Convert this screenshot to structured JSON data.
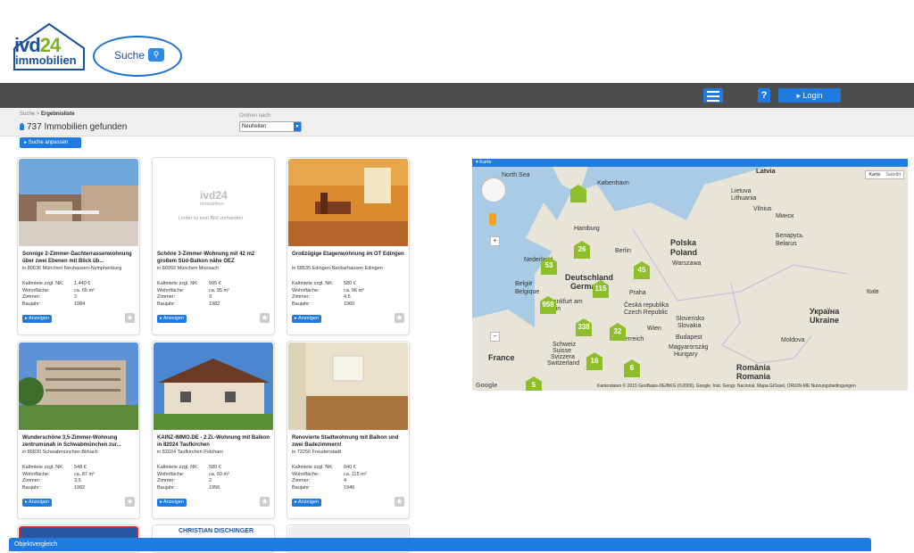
{
  "header": {
    "logo_line1": "ivd",
    "logo_line1_accent": "24",
    "logo_line2": "immobilien",
    "search_label": "Suche",
    "login_label": "Login",
    "help_label": "?"
  },
  "subbar": {
    "breadcrumb_root": "Suche",
    "breadcrumb_sep": ">",
    "breadcrumb_current": "Ergebnisliste",
    "result_count": "737 Immobilien gefunden",
    "sort_label": "Ordnen nach",
    "sort_value": "Neuheiten",
    "adjust_button": "Suche anpassen"
  },
  "listings": [
    {
      "title": "Sonnige 2-Zimmer-Dachterrassenwohnung über zwei Ebenen mit Blick üb...",
      "location": "in 80636 München Neuhausen-Nymphenburg",
      "rent": "1.440 €",
      "area": "ca. 65 m²",
      "rooms": "2",
      "year": "1984"
    },
    {
      "title": "Schöne 3-Zimmer-Wohnung mit 42 m2 großem Süd-Balkon nähe OEZ",
      "location": "in 80992 München Moosach",
      "rent": "995 €",
      "area": "ca. 95 m²",
      "rooms": "3",
      "year": "1982"
    },
    {
      "title": "Großzügige Etagenwohnung im OT Edingen",
      "location": "in 68535 Edingen-Neckarhausen Edingen",
      "rent": "580 €",
      "area": "ca. 96 m²",
      "rooms": "4,5",
      "year": "1960"
    },
    {
      "title": "Wunderschöne 3,5-Zimmer-Wohnung zentrumsnah in Schwabmünchen zur...",
      "location": "in 86830 Schwabmünchen Birkach",
      "rent": "548 €",
      "area": "ca. 87 m²",
      "rooms": "3,5",
      "year": "1982"
    },
    {
      "title": "KAINZ-IMMO.DE - 2 Zi.-Wohnung mit Balkon in 82024 Taufkirchen",
      "location": "in 82024 Taufkirchen Potzham",
      "rent": "580 €",
      "area": "ca. 60 m²",
      "rooms": "2",
      "year": "1956"
    },
    {
      "title": "Renovierte Stadtwohnung mit Balkon und zwei Badezimmern!",
      "location": "in 72250 Freudenstadt",
      "rent": "640 €",
      "area": "ca. 115 m²",
      "rooms": "4",
      "year": "1949"
    }
  ],
  "listing_labels": {
    "rent": "Kaltmiete zzgl. NK:",
    "area": "Wohnfläche:",
    "rooms": "Zimmer:",
    "year": "Baujahr:",
    "show_button": "Anzeigen",
    "no_image_text": "Leider ist kein Bild vorhanden.",
    "no_image_logo": "ivd24",
    "no_image_logo_sub": "immobilien",
    "partial_card_text": "CHRISTIAN DISCHINGER"
  },
  "map": {
    "header": "Karte",
    "maptype_map": "Karte",
    "maptype_sat": "Satellit",
    "labels": [
      "North Sea",
      "København",
      "Latvia",
      "Lietuva",
      "Lithuania",
      "Vilnius",
      "Hamburg",
      "Berlin",
      "Polska",
      "Poland",
      "Warszawa",
      "Минск",
      "Беларусь",
      "Belarus",
      "Deutschland",
      "Germany",
      "Praha",
      "Nederland",
      "België",
      "Belgique",
      "Frankfurt am Main",
      "Česká republika",
      "Czech Republic",
      "Slovensko",
      "Slovakia",
      "Україна",
      "Ukraine",
      "Schweiz",
      "Suisse",
      "Svizzera",
      "Switzerland",
      "Österreich",
      "Wien",
      "Budapest",
      "Magyarország",
      "Hungary",
      "Moldova",
      "France",
      "România",
      "Romania",
      "Київ"
    ],
    "markers": [
      "26",
      "53",
      "45",
      "115",
      "958",
      "338",
      "32",
      "16",
      "6",
      "5"
    ],
    "credit": "Kartendaten © 2015 GeoBasis-DE/BKG (©2009), Google, Inst. Geogr. Nacional, Mapa GISrael, ORION-ME   Nutzungsbedingungen",
    "google": "Google",
    "zoom_in": "+",
    "zoom_out": "−"
  },
  "footer": {
    "compare_bar": "Objektvergleich"
  }
}
